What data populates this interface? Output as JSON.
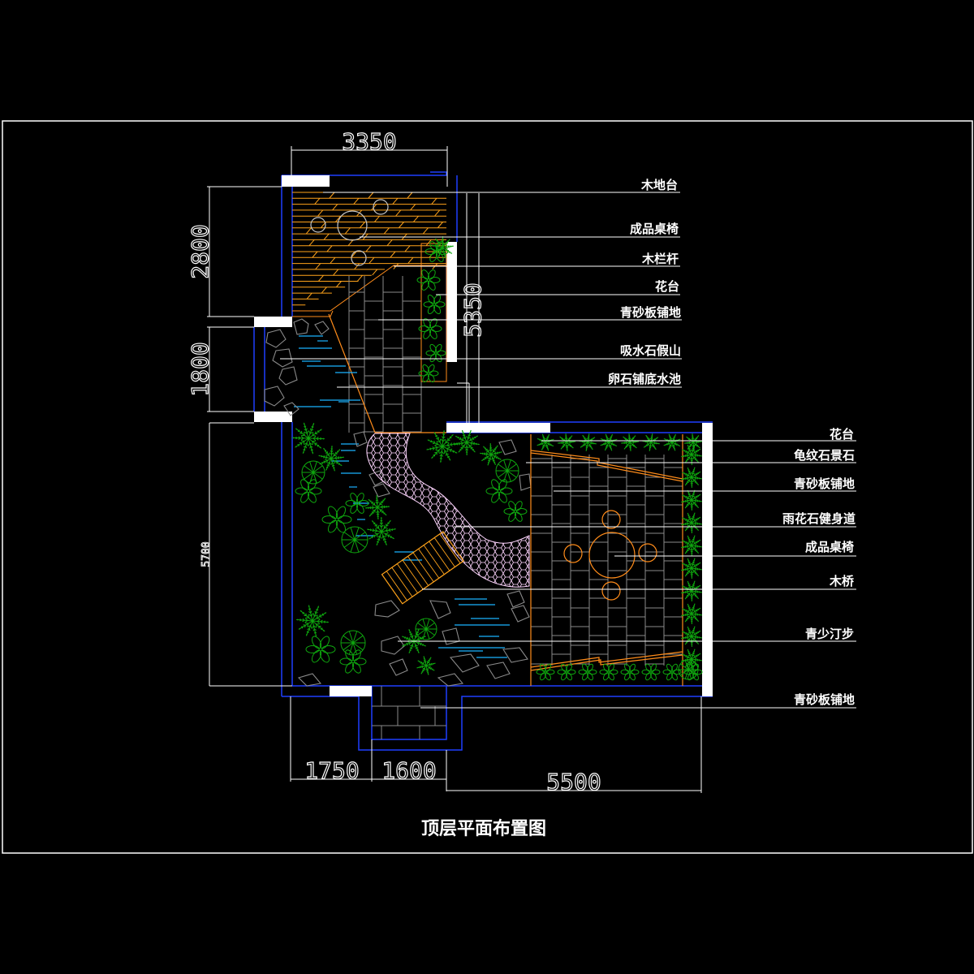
{
  "drawing": {
    "title": "顶层平面布置图",
    "colors": {
      "background": "#000000",
      "frame": "#ffffff",
      "wall": "#1f3fff",
      "wood": "#ffa31a",
      "edge": "#ff8c1a",
      "paving": "#8a8a8a",
      "plants": "#0fa60f",
      "water": "#1ab2ff",
      "rock": "#8a8a8a",
      "path": "#ffd6ff"
    },
    "dimensions": {
      "top_width": "3350",
      "left_upper": "2800",
      "left_middle": "1800",
      "left_lower": "5700",
      "right_upper": "5350",
      "bottom_left": "1750",
      "bottom_middle": "1600",
      "bottom_right": "5500"
    },
    "callouts_upper": [
      "木地台",
      "成品桌椅",
      "木栏杆",
      "花台",
      "青砂板铺地",
      "吸水石假山",
      "卵石铺底水池"
    ],
    "callouts_lower": [
      "花台",
      "龟纹石景石",
      "青砂板铺地",
      "雨花石健身道",
      "成品桌椅",
      "木桥",
      "青少汀步",
      "青砂板铺地"
    ]
  }
}
